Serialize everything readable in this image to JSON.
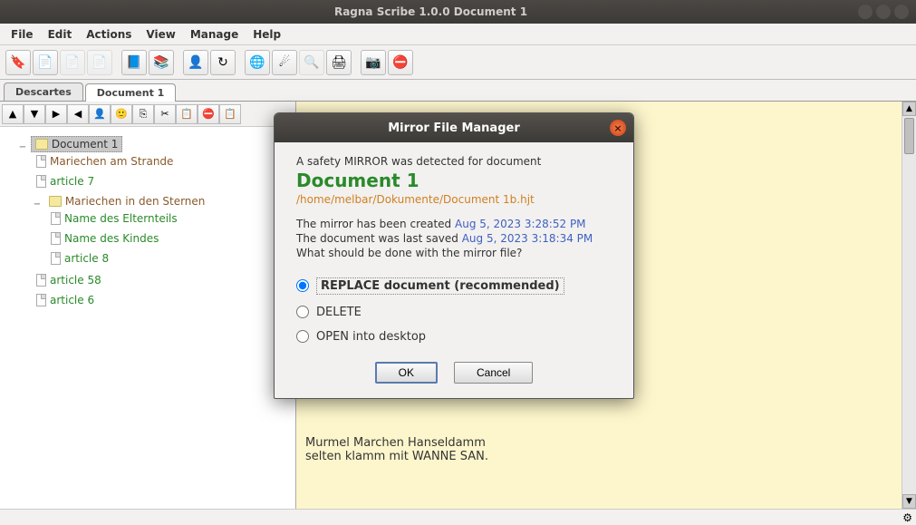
{
  "titlebar": {
    "title": "Ragna Scribe 1.0.0  Document 1"
  },
  "menu": {
    "file": "File",
    "edit": "Edit",
    "actions": "Actions",
    "view": "View",
    "manage": "Manage",
    "help": "Help"
  },
  "tabs": {
    "t0": "Descartes",
    "t1": "Document 1"
  },
  "tree": {
    "root": "Document 1",
    "n0": "Mariechen am Strande",
    "n1": "article 7",
    "n2": "Mariechen in den Sternen",
    "n2a": "Name des Elternteils",
    "n2b": "Name des Kindes",
    "n2c": "article 8",
    "n3": "article 58",
    "n4": "article 6"
  },
  "editor": {
    "line1": "Murmel Marchen Hanseldamm",
    "line2": "selten klamm mit WANNE SAN."
  },
  "dialog": {
    "title": "Mirror File Manager",
    "intro": "A safety MIRROR was detected for document",
    "docname": "Document 1",
    "path": "/home/melbar/Dokumente/Document 1b.hjt",
    "created_label": "The mirror has been created ",
    "created_ts": "Aug 5, 2023 3:28:52 PM",
    "saved_label": "The document was last saved ",
    "saved_ts": "Aug 5, 2023 3:18:34 PM",
    "question": "What should be done with the mirror file?",
    "opt_replace": "REPLACE document (recommended)",
    "opt_delete": "DELETE",
    "opt_open": "OPEN into desktop",
    "ok": "OK",
    "cancel": "Cancel"
  },
  "icons": {
    "bookmark": "🔖",
    "note": "📄",
    "book": "📘",
    "books": "📚",
    "user": "👤",
    "refresh": "↻",
    "globe": "🌐",
    "fire": "☄",
    "search": "🔍",
    "print": "🖨",
    "camera": "📷",
    "stop": "⛔",
    "up": "▲",
    "down": "▼",
    "right": "▶",
    "left": "◀",
    "face": "🙂",
    "copy": "⎘",
    "cut": "✂",
    "paste": "📋",
    "gear": "⚙"
  }
}
